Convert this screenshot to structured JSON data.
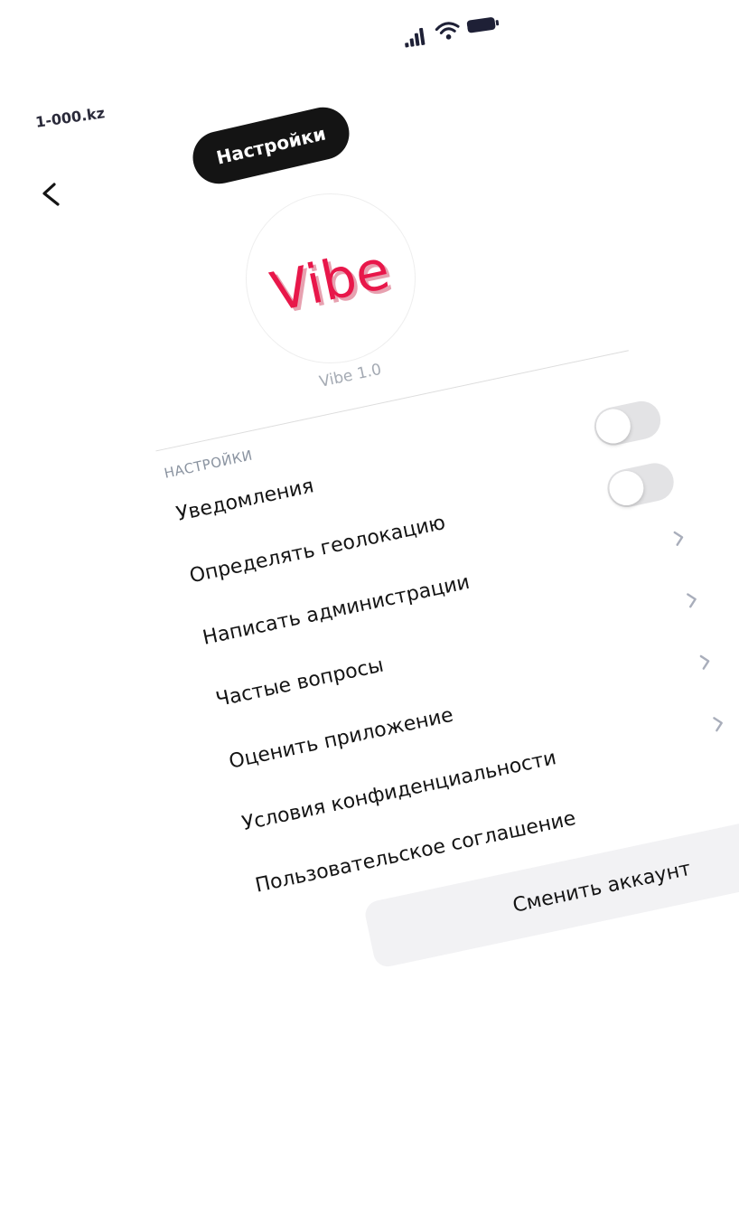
{
  "status_bar": {
    "icons": [
      "signal-icon",
      "wifi-icon",
      "battery-icon"
    ]
  },
  "watermark": "1-000.kz",
  "header": {
    "title": "Настройки",
    "back_icon": "chevron-left-icon"
  },
  "app": {
    "logo_text": "Vibe",
    "version": "Vibe 1.0",
    "brand_color": "#e8174a"
  },
  "settings": {
    "section_label": "НАСТРОЙКИ",
    "toggles": [
      {
        "label": "Уведомления",
        "on": false
      },
      {
        "label": "Определять геолокацию",
        "on": false
      }
    ],
    "links": [
      {
        "label": "Написать администрации"
      },
      {
        "label": "Частые вопросы"
      },
      {
        "label": "Оценить приложение"
      },
      {
        "label": "Условия конфиденциальности"
      },
      {
        "label": "Пользовательское соглашение"
      }
    ]
  },
  "switch_account": {
    "label": "Сменить аккаунт"
  }
}
